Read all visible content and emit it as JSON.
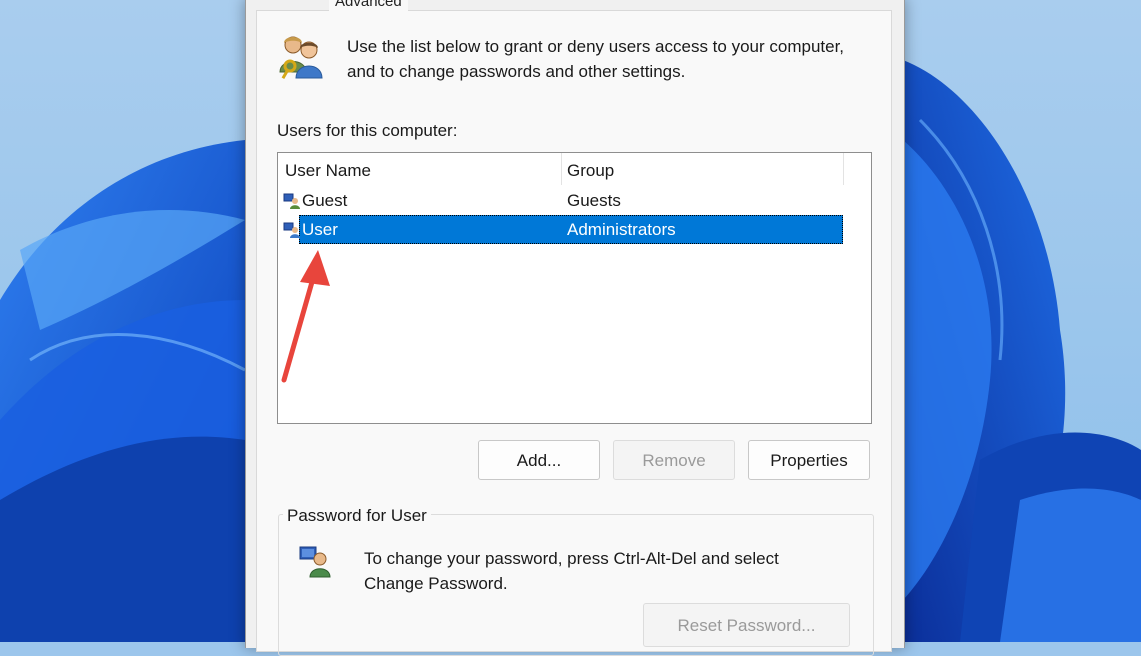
{
  "dialog": {
    "tab_label": "Advanced",
    "intro_line1": "Use the list below to grant or deny users access to your computer,",
    "intro_line2": "and to change passwords and other settings.",
    "users_label": "Users for this computer:",
    "columns": [
      "User Name",
      "Group"
    ],
    "rows": [
      {
        "name": "Guest",
        "group": "Guests",
        "selected": false
      },
      {
        "name": "User",
        "group": "Administrators",
        "selected": true
      }
    ],
    "buttons": {
      "add": "Add...",
      "remove": "Remove",
      "properties": "Properties"
    },
    "password_group": {
      "title": "Password for User",
      "line1": "To change your password, press Ctrl-Alt-Del and select",
      "line2": "Change Password.",
      "reset_button": "Reset Password..."
    }
  },
  "colors": {
    "selection": "#0078d7",
    "annotation_arrow": "#e8453c",
    "wallpaper_blue": "#1464d8"
  },
  "icons": {
    "users": "users-key-icon",
    "user_row": "user-monitor-icon",
    "password": "user-password-icon"
  }
}
